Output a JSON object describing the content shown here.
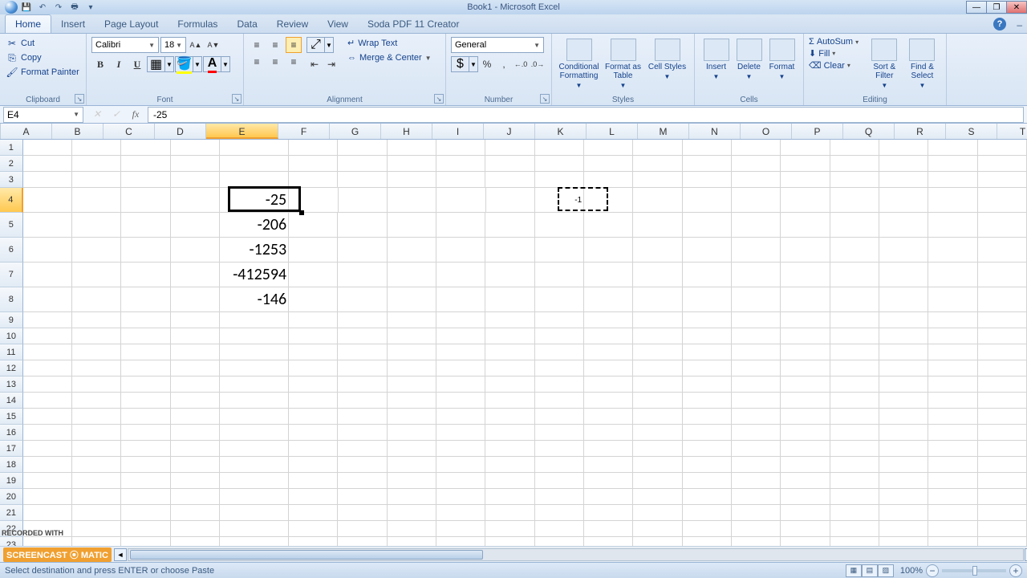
{
  "title": "Book1 - Microsoft Excel",
  "tabs": [
    "Home",
    "Insert",
    "Page Layout",
    "Formulas",
    "Data",
    "Review",
    "View",
    "Soda PDF 11 Creator"
  ],
  "active_tab": 0,
  "clipboard": {
    "cut": "Cut",
    "copy": "Copy",
    "format_painter": "Format Painter",
    "group": "Clipboard"
  },
  "font": {
    "name": "Calibri",
    "size": "18",
    "group": "Font"
  },
  "alignment": {
    "wrap": "Wrap Text",
    "merge": "Merge & Center",
    "group": "Alignment"
  },
  "number": {
    "format": "General",
    "group": "Number"
  },
  "styles": {
    "cond": "Conditional Formatting",
    "table": "Format as Table",
    "cell": "Cell Styles",
    "group": "Styles"
  },
  "cells": {
    "insert": "Insert",
    "delete": "Delete",
    "format": "Format",
    "group": "Cells"
  },
  "editing": {
    "autosum": "AutoSum",
    "fill": "Fill",
    "clear": "Clear",
    "sort": "Sort & Filter",
    "find": "Find & Select",
    "group": "Editing"
  },
  "name_box": "E4",
  "formula": "-25",
  "columns": [
    "A",
    "B",
    "C",
    "D",
    "E",
    "F",
    "G",
    "H",
    "I",
    "J",
    "K",
    "L",
    "M",
    "N",
    "O",
    "P",
    "Q",
    "R",
    "S",
    "T"
  ],
  "wide_col_index": 4,
  "selected_col_index": 4,
  "row_count": 16,
  "tall_row_start": 3,
  "tall_row_end": 7,
  "selected_row": 3,
  "cells_data": {
    "E4": "-25",
    "E5": "-206",
    "E6": "-1253",
    "E7": "-412594",
    "E8": "-146",
    "K4": "-1"
  },
  "marching_cell": "K4",
  "watermark1": "RECORDED WITH",
  "watermark2": "SCREENCAST ⦿ MATIC",
  "status_msg": "Select destination and press ENTER or choose Paste",
  "zoom": "100%"
}
